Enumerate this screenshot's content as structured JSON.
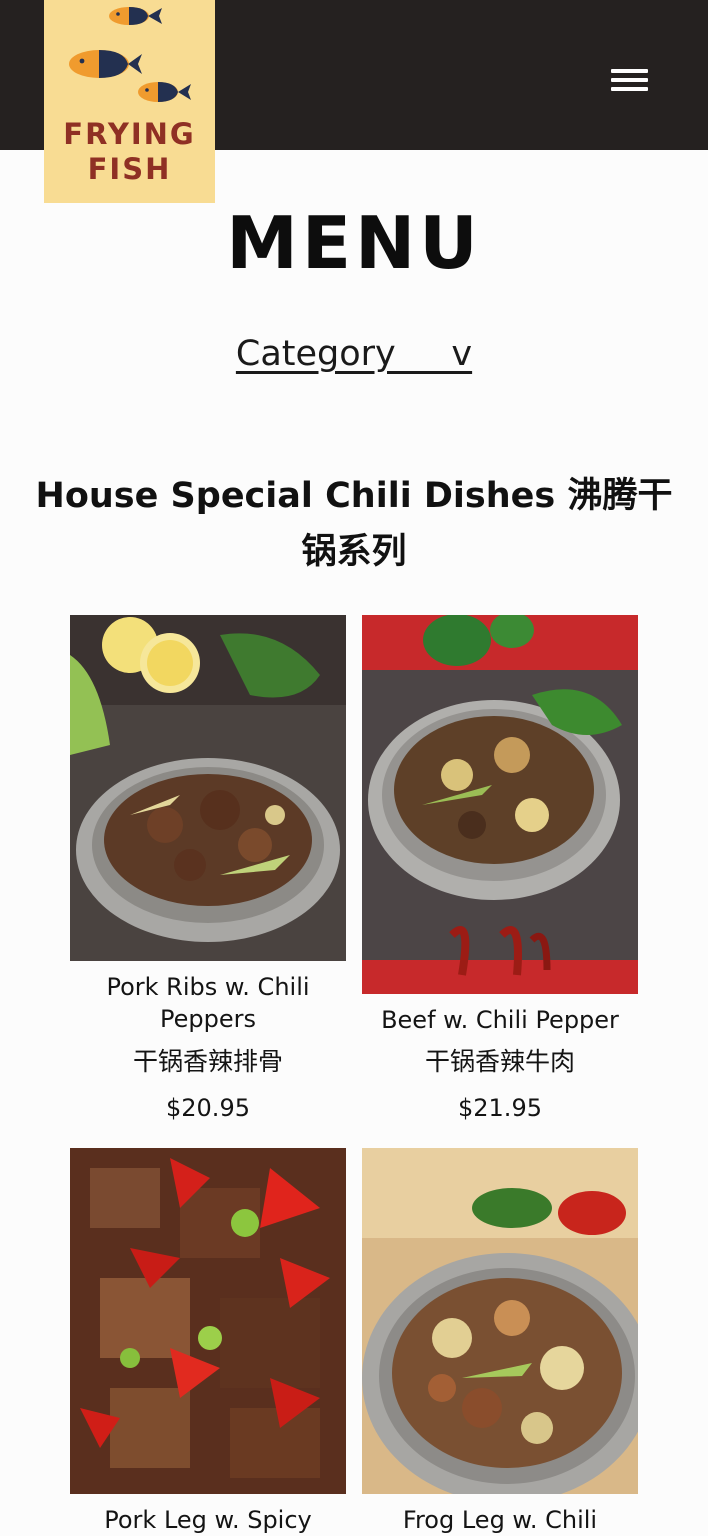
{
  "brand": {
    "logo_text_line1": "FRYING",
    "logo_text_line2": "FISH",
    "logo_bg": "#f8dc93",
    "logo_text_color": "#8f3024"
  },
  "nav": {
    "menu_icon": "hamburger-menu-icon"
  },
  "page": {
    "title": "MENU"
  },
  "filter": {
    "label": "Category     v"
  },
  "section": {
    "title_en": "House Special Chili Dishes",
    "title_cn": "沸腾干锅系列"
  },
  "dishes": [
    {
      "name": "Pork Ribs w. Chili Peppers",
      "name_cn": "干锅香辣排骨",
      "price": "$20.95"
    },
    {
      "name": "Beef w. Chili Pepper",
      "name_cn": "干锅香辣牛肉",
      "price": "$21.95"
    },
    {
      "name": "Pork Leg w. Spicy",
      "name_cn": "",
      "price": ""
    },
    {
      "name": "Frog Leg w. Chili",
      "name_cn": "",
      "price": ""
    }
  ],
  "colors": {
    "header_bg": "#252120",
    "page_bg": "#fcfcfc"
  }
}
